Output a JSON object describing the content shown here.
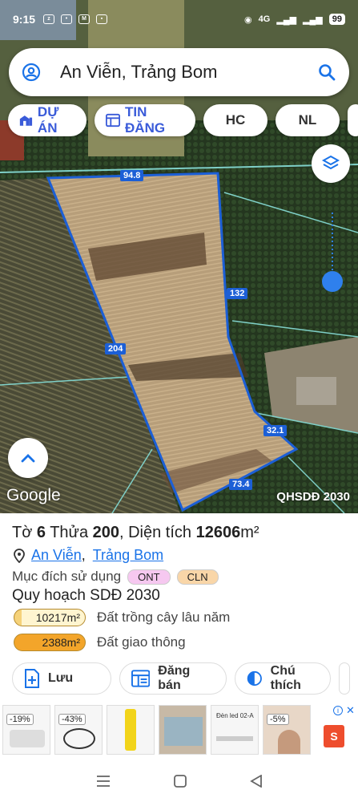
{
  "status": {
    "time": "9:15",
    "network": "4G",
    "battery": "99"
  },
  "search": {
    "title": "An Viễn, Trảng Bom"
  },
  "chips": [
    {
      "label": "DỰ ÁN"
    },
    {
      "label": "TIN ĐĂNG"
    },
    {
      "label": "HC"
    },
    {
      "label": "NL"
    }
  ],
  "map": {
    "edge_labels": [
      "94.8",
      "132",
      "204",
      "32.1",
      "73.4"
    ],
    "brand": "Google",
    "overlay": "QHSDĐ 2030"
  },
  "parcel": {
    "sheet_prefix": "Tờ ",
    "sheet_no": "6",
    "parcel_prefix": " Thửa ",
    "parcel_no": "200",
    "area_prefix": ", Diện tích ",
    "area_value": "12606",
    "area_unit": "m²",
    "commune": "An Viễn",
    "district": "Trảng Bom",
    "purpose_label": "Mục đích sử dụng",
    "purpose_tags": [
      {
        "code": "ONT",
        "color": "#f6c8f0"
      },
      {
        "code": "CLN",
        "color": "#f9d6a8"
      }
    ],
    "plan_title": "Quy hoạch SDĐ 2030",
    "plan_rows": [
      {
        "area": "10217m²",
        "label": "Đất trồng cây lâu năm"
      },
      {
        "area": "2388m²",
        "label": "Đất giao thông"
      }
    ]
  },
  "actions": [
    {
      "label": "Lưu",
      "icon": "add-file-icon"
    },
    {
      "label": "Đăng bán",
      "icon": "listing-icon"
    },
    {
      "label": "Chú thích",
      "icon": "legend-icon"
    }
  ],
  "ad": {
    "discounts": [
      "-19%",
      "-43%",
      "-5%"
    ],
    "product_text": "Đèn led 02-A",
    "info": "i",
    "close": "✕",
    "brand": "S"
  },
  "colors": {
    "accent": "#1a73e8",
    "parcel_line": "#1c5fd6",
    "chip_blue": "#3a5bd9"
  }
}
